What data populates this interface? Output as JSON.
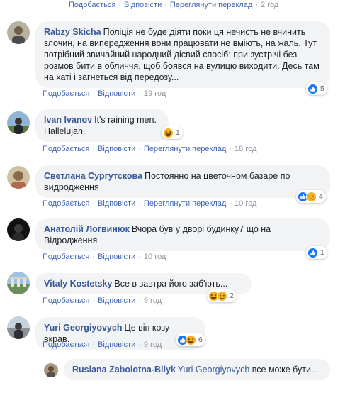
{
  "labels": {
    "like": "Подобається",
    "reply": "Відповісти",
    "translate": "Переглянути переклад",
    "sep": "·"
  },
  "top_actions": {
    "time": "2 год"
  },
  "comments": [
    {
      "name": "Rabzy Skicha",
      "text": "Поліція не буде діяти поки ця нечисть не вчинить злочин, на випередження вони працювати не вміють, на жаль. Тут потрібний звичайний народний дієвий спосіб: при зустрічі без розмов бити в обличчя, щоб боявся на вулицю виходити. Десь там на хаті і загнеться від передозу...",
      "time": "19 год",
      "reaction_count": "5",
      "reactions": [
        "like"
      ]
    },
    {
      "name": "Ivan Ivanov",
      "text": "It's raining men. Hallelujah.",
      "time": "18 год",
      "reaction_count": "1",
      "reactions": [
        "haha"
      ]
    },
    {
      "name": "Светлана Сургутскова",
      "text": "Постоянно на цветочном базаре по видродження",
      "time": "10 год",
      "reaction_count": "4",
      "reactions": [
        "like",
        "sad"
      ]
    },
    {
      "name": "Анатолій Логвинюк",
      "text": "Вчора був у дворі будинку7 що на Відродження",
      "time": "10 год",
      "reaction_count": "1",
      "reactions": [
        "like"
      ]
    },
    {
      "name": "Vitaly Kostetsky",
      "text": "Все в завтра його заб'ють...",
      "time": "9 год",
      "reaction_count": "2",
      "reactions": [
        "haha",
        "sad"
      ]
    },
    {
      "name": "Yuri Georgiyovych",
      "text": "Це він козу вкрав.",
      "time": "9 год",
      "reaction_count": "6",
      "reactions": [
        "like",
        "haha"
      ]
    }
  ],
  "reply": {
    "name": "Ruslana Zabolotna-Bilyk",
    "mention": "Yuri Georgiyovych",
    "text": "все може бути..."
  },
  "colors": {
    "link": "#4267b2",
    "name": "#385898",
    "bubble": "#f2f3f5",
    "like": "#1877f2",
    "emoji": "#f7b125"
  }
}
